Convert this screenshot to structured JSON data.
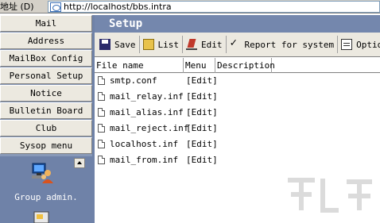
{
  "address_bar": {
    "label": "地址 (D)",
    "url": "http://localhost/bbs.intra"
  },
  "sidebar": {
    "items": [
      {
        "label": "Mail"
      },
      {
        "label": "Address"
      },
      {
        "label": "MailBox Config"
      },
      {
        "label": "Personal Setup"
      },
      {
        "label": "Notice"
      },
      {
        "label": "Bulletin Board"
      },
      {
        "label": "Club"
      },
      {
        "label": "Sysop menu"
      }
    ],
    "group": {
      "label": "Group admin.",
      "icon": "users-icon"
    }
  },
  "panel": {
    "title": "Setup"
  },
  "toolbar": {
    "save_label": "Save",
    "list_label": "List",
    "edit_label": "Edit",
    "report_label": "Report for system",
    "options_label": "Optio"
  },
  "table": {
    "headers": {
      "file_name": "File name",
      "menu": "Menu",
      "description": "Description"
    },
    "rows": [
      {
        "file": "smtp.conf",
        "menu": "[Edit]",
        "description": ""
      },
      {
        "file": "mail_relay.inf",
        "menu": "[Edit]",
        "description": ""
      },
      {
        "file": "mail_alias.inf",
        "menu": "[Edit]",
        "description": ""
      },
      {
        "file": "mail_reject.inf",
        "menu": "[Edit]",
        "description": ""
      },
      {
        "file": "localhost.inf",
        "menu": "[Edit]",
        "description": ""
      },
      {
        "file": "mail_from.inf",
        "menu": "[Edit]",
        "description": ""
      }
    ]
  },
  "colors": {
    "sidebar_bg": "#8899b8",
    "title_bg": "#7487ad",
    "button_face": "#ece9e0"
  }
}
